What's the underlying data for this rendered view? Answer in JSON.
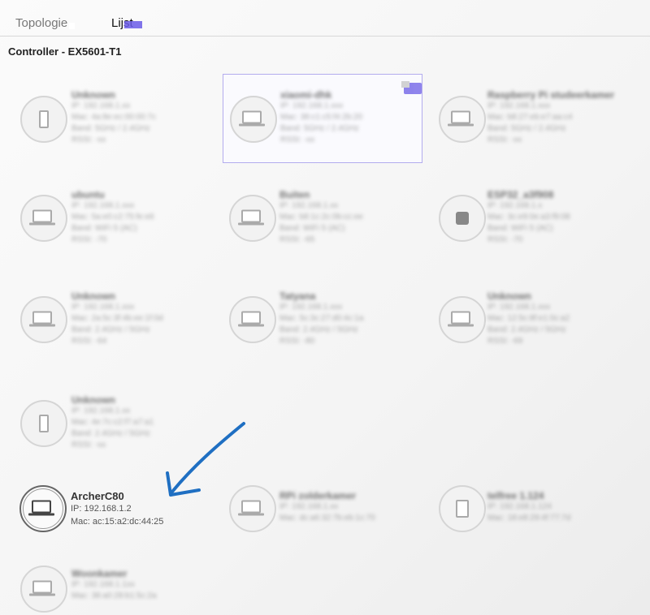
{
  "tabs": {
    "topology": "Topologie",
    "list": "Lijst"
  },
  "controller": {
    "title": "Controller - EX5601-T1"
  },
  "devices": [
    {
      "name": "Unknown",
      "line1": "IP: 192.168.1.xx",
      "line2": "Mac: 4a:8e:ec:00:00:7c",
      "line3": "Band: 5GHz / 2.4GHz",
      "line4": "RSSI: -xx"
    },
    {
      "name": "xiaomi-dhk",
      "line1": "IP: 192.168.1.xxx",
      "line2": "Mac: 38:c1:c5:f4:2b:20",
      "line3": "Band: 5GHz / 2.4GHz",
      "line4": "RSSI: -xx"
    },
    {
      "name": "Raspberry Pi studeerkamer",
      "line1": "IP: 192.168.1.xxx",
      "line2": "Mac: b8:27:eb:e7:aa:c4",
      "line3": "Band: 5GHz / 2.4GHz",
      "line4": "RSSI: -xx"
    },
    {
      "name": "ubuntu",
      "line1": "IP: 192.168.1.xxx",
      "line2": "Mac: 5a:e0:c2:75:fe:e6",
      "line3": "Band: WiFi 5 (AC)",
      "line4": "RSSI: -70"
    },
    {
      "name": "Buiten",
      "line1": "IP: 192.168.1.xx",
      "line2": "Mac: b8:1c:2c:0b:cc:ee",
      "line3": "Band: WiFi 5 (AC)",
      "line4": "RSSI: -65"
    },
    {
      "name": "ESP32_a3f908",
      "line1": "IP: 192.168.1.x",
      "line2": "Mac: 3c:e9:0e:a3:f9:08",
      "line3": "Band: WiFi 5 (AC)",
      "line4": "RSSI: -70"
    },
    {
      "name": "Unknown",
      "line1": "IP: 192.168.1.xxx",
      "line2": "Mac: 2a:5c:3f:4b:ee:1f:0d",
      "line3": "Band: 2.4GHz / 5GHz",
      "line4": "RSSI: -64"
    },
    {
      "name": "Tatyana",
      "line1": "IP: 192.168.1.xxx",
      "line2": "Mac: 5c:3c:27:d0:4c:1a",
      "line3": "Band: 2.4GHz / 5GHz",
      "line4": "RSSI: -80"
    },
    {
      "name": "Unknown",
      "line1": "IP: 192.168.1.xxx",
      "line2": "Mac: 12:5c:8f:e1:0c:a2",
      "line3": "Band: 2.4GHz / 5GHz",
      "line4": "RSSI: -69"
    },
    {
      "name": "Unknown",
      "line1": "IP: 192.168.1.xx",
      "line2": "Mac: 4e:7c:c2:f7:a7:a1",
      "line3": "Band: 2.4GHz / 5GHz",
      "line4": "RSSI: -xx"
    },
    {
      "name": "ArcherC80",
      "line1": "IP: 192.168.1.2",
      "line2": "Mac: ac:15:a2:dc:44:25"
    },
    {
      "name": "RPi zolderkamer",
      "line1": "IP: 192.168.1.xx",
      "line2": "Mac: dc:a6:32:7b:eb:1c:70"
    },
    {
      "name": "telfree 1.124",
      "line1": "IP: 192.168.1.124",
      "line2": "Mac: 18:e8:29:4f:77:7d"
    },
    {
      "name": "Woonkamer",
      "line1": "IP: 192.168.1.1xx",
      "line2": "Mac: 38:a0:28:b1:5c:2a"
    }
  ],
  "colors": {
    "accent": "#6b5ce7",
    "arrow": "#1f6fc2",
    "selectedBorder": "#b3acee"
  }
}
